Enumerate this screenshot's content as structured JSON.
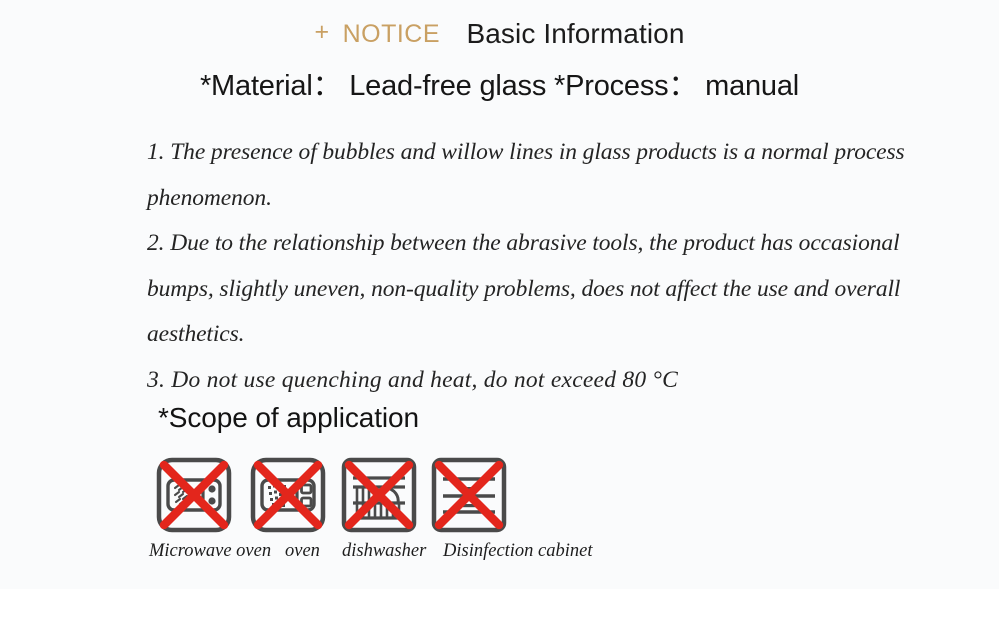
{
  "page": {
    "background_color": "#ffffff",
    "panel_color": "#fafbfc"
  },
  "header": {
    "plus_icon": "+",
    "notice_label": "NOTICE",
    "notice_color": "#c9a063",
    "title": "Basic Information",
    "title_color": "#1c1c1c"
  },
  "subtitle": {
    "text": "*Material： Lead-free glass *Process： manual"
  },
  "notes": {
    "lines": [
      "1. The presence of bubbles and willow lines in glass products is a normal process",
      "phenomenon.",
      "2. Due to the relationship between the abrasive tools, the product has occasional",
      "bumps, slightly uneven, non-quality problems, does not affect the use and overall",
      "aesthetics.",
      "3. Do not use quenching and heat, do not exceed 80 °C"
    ]
  },
  "scope": {
    "heading": "*Scope of application",
    "icon_border_color": "#4a4a4a",
    "cross_color": "#e3261c",
    "items": [
      {
        "icon": "microwave-oven-prohibited-icon",
        "label": "Microwave oven"
      },
      {
        "icon": "oven-prohibited-icon",
        "label": "oven"
      },
      {
        "icon": "dishwasher-prohibited-icon",
        "label": "dishwasher"
      },
      {
        "icon": "disinfection-cabinet-prohibited-icon",
        "label": "Disinfection cabinet"
      }
    ]
  }
}
